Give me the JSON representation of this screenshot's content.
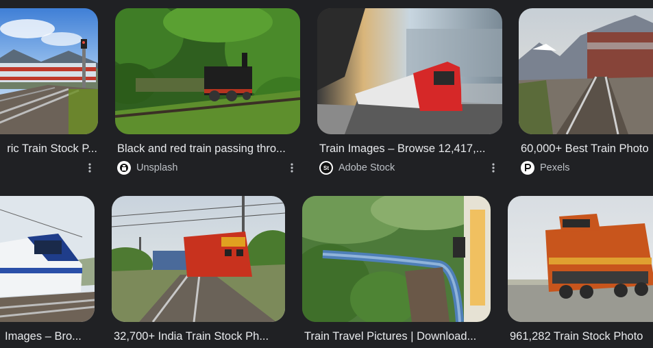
{
  "results": [
    {
      "title": "ric Train Stock P...",
      "source": "",
      "source_icon": "",
      "has_menu": true
    },
    {
      "title": "Black and red train passing thro...",
      "source": "Unsplash",
      "source_icon": "unsplash-icon",
      "has_menu": true
    },
    {
      "title": "Train Images – Browse 12,417,...",
      "source": "Adobe Stock",
      "source_icon": "adobe-stock-icon",
      "has_menu": true
    },
    {
      "title": "60,000+ Best Train Photo",
      "source": "Pexels",
      "source_icon": "pexels-icon",
      "has_menu": false
    },
    {
      "title": "Images – Bro...",
      "source": "",
      "source_icon": "",
      "has_menu": false
    },
    {
      "title": "32,700+ India Train Stock Ph...",
      "source": "",
      "source_icon": "",
      "has_menu": false
    },
    {
      "title": "Train Travel Pictures | Download...",
      "source": "",
      "source_icon": "",
      "has_menu": false
    },
    {
      "title": "961,282 Train Stock Photo",
      "source": "",
      "source_icon": "",
      "has_menu": false
    }
  ],
  "icons": {
    "more": "more-vertical-icon",
    "adobe_letters": "St"
  }
}
